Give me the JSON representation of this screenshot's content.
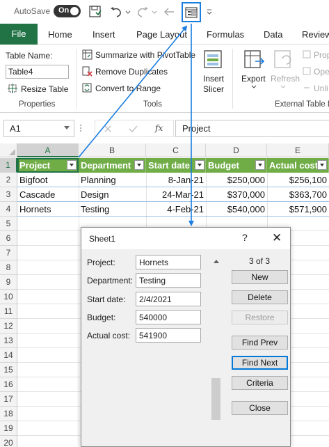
{
  "titlebar": {
    "autosave_label": "AutoSave",
    "autosave_state": "On",
    "icons": [
      "save-icon",
      "undo-icon",
      "redo-icon",
      "back-icon",
      "form-icon",
      "customize-qat-icon"
    ]
  },
  "ribbon_tabs": [
    "File",
    "Home",
    "Insert",
    "Page Layout",
    "Formulas",
    "Data",
    "Review"
  ],
  "ribbon": {
    "properties": {
      "table_name_label": "Table Name:",
      "table_name_value": "Table4",
      "resize_label": "Resize Table",
      "group_label": "Properties"
    },
    "tools": {
      "summarize": "Summarize with PivotTable",
      "remove_duplicates": "Remove Duplicates",
      "convert_range": "Convert to Range",
      "insert_slicer_1": "Insert",
      "insert_slicer_2": "Slicer",
      "group_label": "Tools"
    },
    "external": {
      "export": "Export",
      "refresh": "Refresh",
      "properties": "Prop",
      "open": "Ope",
      "unlink": "Unli",
      "group_label": "External Table D"
    }
  },
  "formula_bar": {
    "name_box": "A1",
    "fx": "fx",
    "content": "Project"
  },
  "grid": {
    "columns": [
      "A",
      "B",
      "C",
      "D",
      "E"
    ],
    "rows": [
      "1",
      "2",
      "3",
      "4",
      "5",
      "6",
      "7",
      "8",
      "9",
      "10",
      "11",
      "12",
      "13",
      "14",
      "15",
      "16",
      "17",
      "18",
      "19",
      "20"
    ],
    "headers": [
      "Project",
      "Department",
      "Start date",
      "Budget",
      "Actual cost"
    ],
    "data": [
      [
        "Bigfoot",
        "Planning",
        "8-Jan-21",
        "$250,000",
        "$256,100"
      ],
      [
        "Cascade",
        "Design",
        "24-Mar-21",
        "$370,000",
        "$363,700"
      ],
      [
        "Hornets",
        "Testing",
        "4-Feb-21",
        "$540,000",
        "$571,900"
      ]
    ]
  },
  "dialog": {
    "title": "Sheet1",
    "help": "?",
    "close": "✕",
    "record_count": "3 of 3",
    "fields": [
      {
        "label": "Project:",
        "value": "Hornets"
      },
      {
        "label": "Department:",
        "value": "Testing"
      },
      {
        "label": "Start date:",
        "value": "2/4/2021"
      },
      {
        "label": "Budget:",
        "value": "540000"
      },
      {
        "label": "Actual cost:",
        "value": "541900"
      }
    ],
    "buttons": {
      "new": "New",
      "delete": "Delete",
      "restore": "Restore",
      "find_prev": "Find Prev",
      "find_next": "Find Next",
      "criteria": "Criteria",
      "close": "Close"
    }
  },
  "colors": {
    "excel_green": "#217346",
    "table_header": "#70ad47",
    "arrow_blue": "#1a7de0"
  }
}
